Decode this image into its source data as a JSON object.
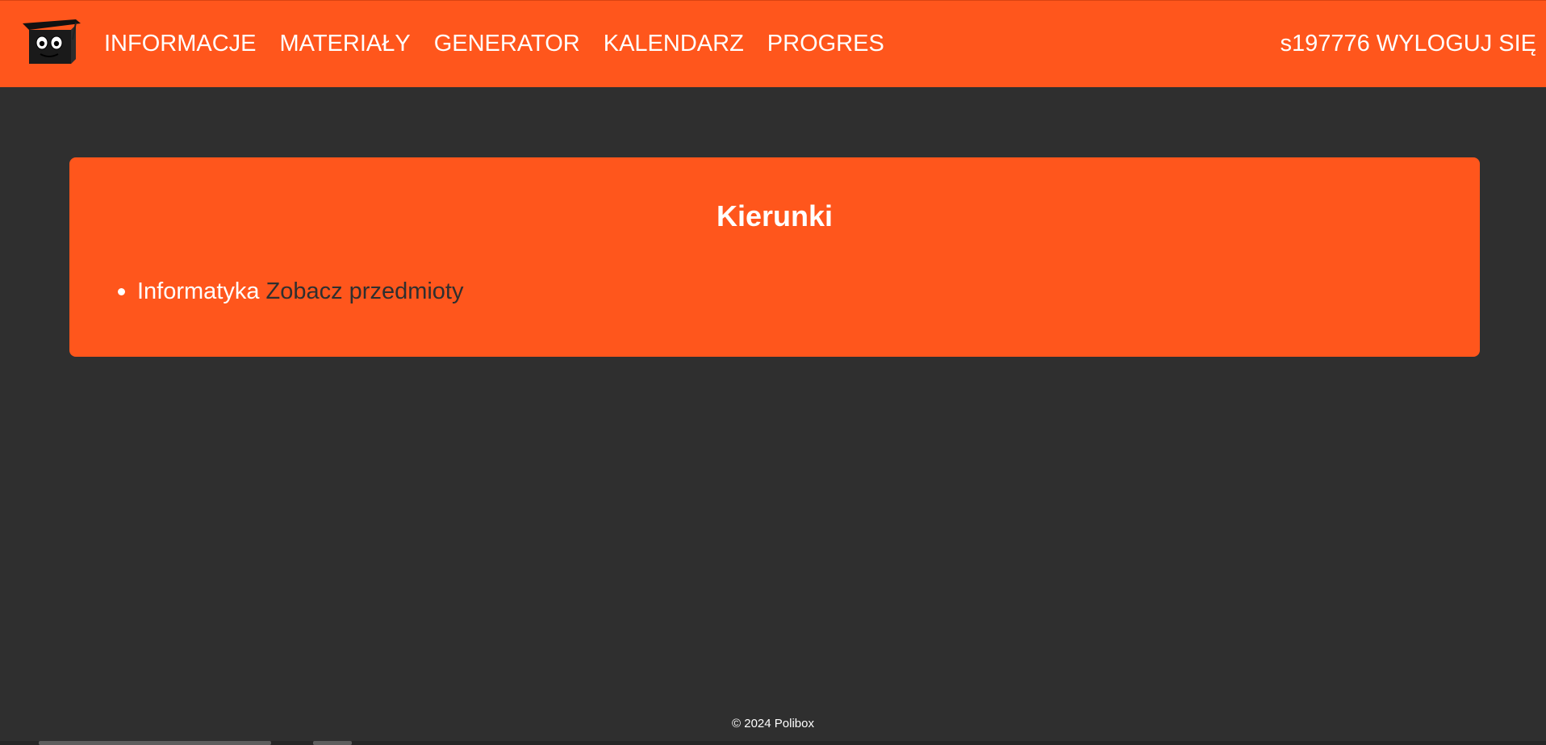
{
  "nav": {
    "items": [
      {
        "label": "INFORMACJE"
      },
      {
        "label": "MATERIAŁY"
      },
      {
        "label": "GENERATOR"
      },
      {
        "label": "KALENDARZ"
      },
      {
        "label": "PROGRES"
      }
    ],
    "username": "s197776",
    "logout_label": "WYLOGUJ SIĘ"
  },
  "main": {
    "title": "Kierunki",
    "courses": [
      {
        "name": "Informatyka",
        "link_label": "Zobacz przedmioty"
      }
    ]
  },
  "footer": {
    "text": "© 2024 Polibox"
  },
  "icons": {
    "logo": "graduation-box-mascot-logo"
  },
  "colors": {
    "accent": "#ff561c",
    "background": "#2f2f2f",
    "text_light": "#ffffff",
    "link_dark": "#2f2f2f"
  }
}
